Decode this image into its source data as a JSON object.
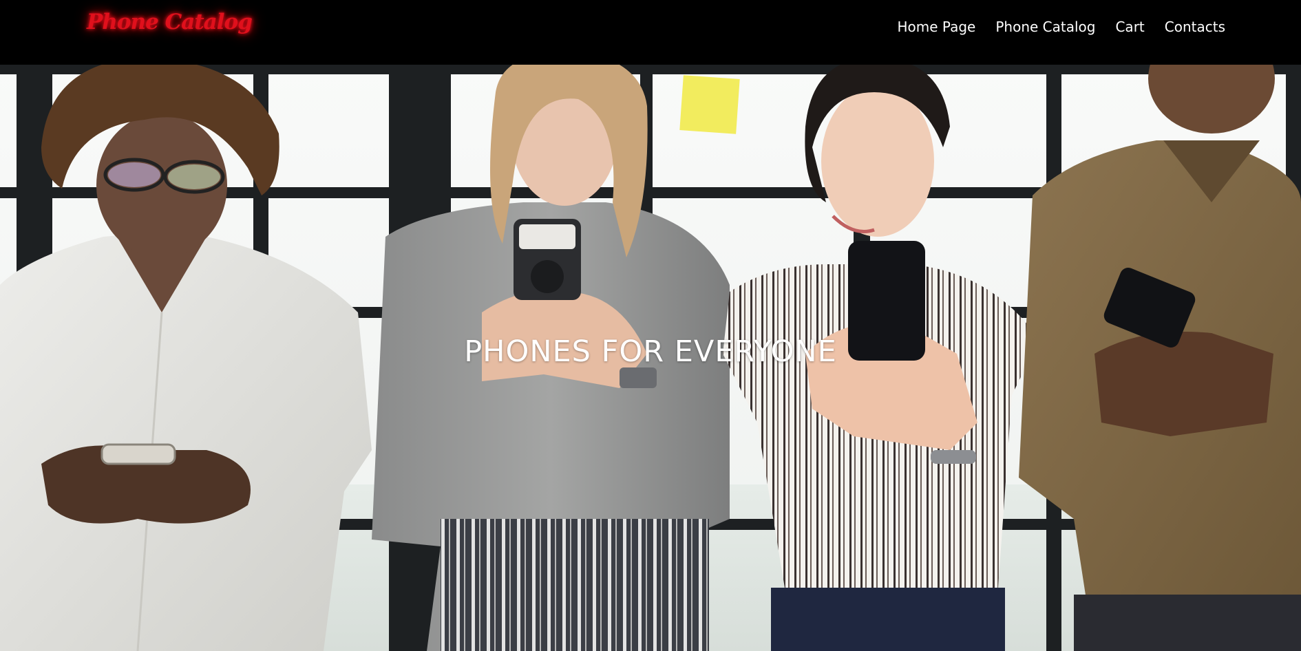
{
  "header": {
    "logo_text": "Phone Catalog",
    "nav": [
      {
        "label": "Home Page"
      },
      {
        "label": "Phone Catalog"
      },
      {
        "label": "Cart"
      },
      {
        "label": "Contacts"
      }
    ]
  },
  "hero": {
    "title": "PHONES FOR EVERYONE",
    "image_description_icon": "people-with-phones-photo"
  },
  "colors": {
    "header_bg": "#000000",
    "logo": "#e0101c",
    "nav_text": "#ffffff",
    "hero_title": "#ffffff"
  }
}
